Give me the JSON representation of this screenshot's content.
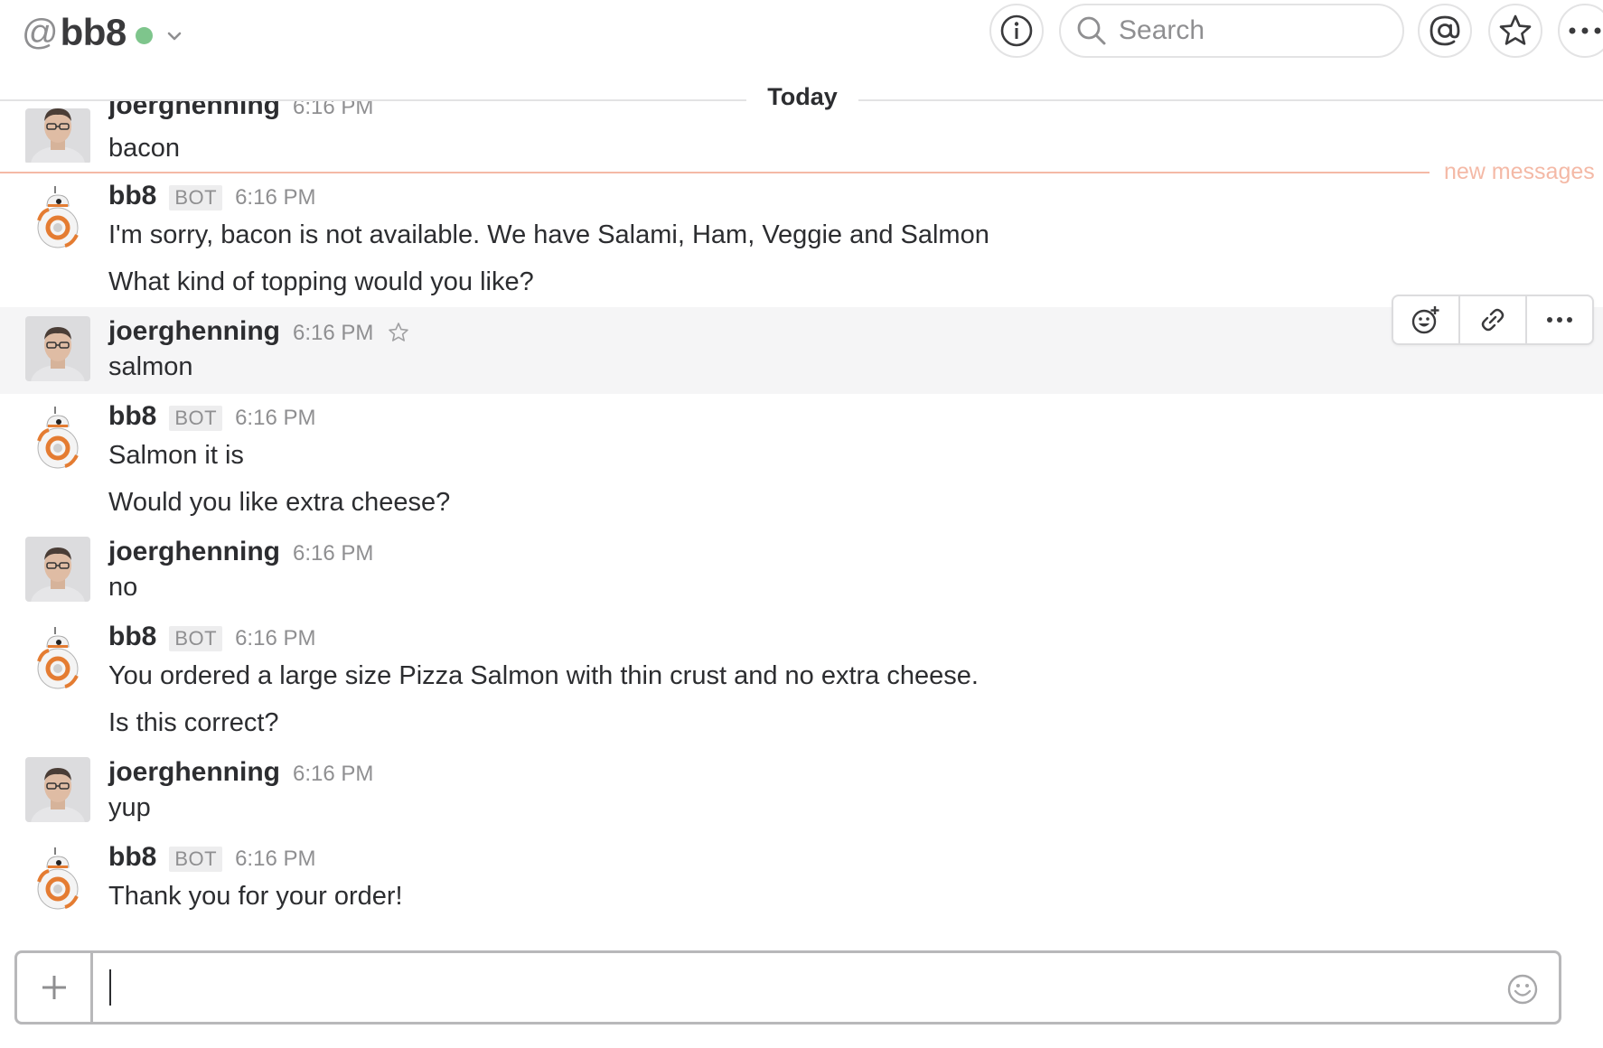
{
  "header": {
    "at_symbol": "@",
    "channel_name": "bb8",
    "search_placeholder": "Search"
  },
  "day_divider": "Today",
  "new_messages_label": "new messages",
  "messages": [
    {
      "author": "joerghenning",
      "time": "6:16 PM",
      "lines": [
        "bacon"
      ]
    },
    {
      "author": "bb8",
      "badge": "BOT",
      "time": "6:16 PM",
      "lines": [
        "I'm sorry, bacon is not available. We have Salami, Ham, Veggie and Salmon",
        "What kind of topping would you like?"
      ]
    },
    {
      "author": "joerghenning",
      "time": "6:16 PM",
      "lines": [
        "salmon"
      ]
    },
    {
      "author": "bb8",
      "badge": "BOT",
      "time": "6:16 PM",
      "lines": [
        "Salmon it is",
        "Would you like extra cheese?"
      ]
    },
    {
      "author": "joerghenning",
      "time": "6:16 PM",
      "lines": [
        "no"
      ]
    },
    {
      "author": "bb8",
      "badge": "BOT",
      "time": "6:16 PM",
      "lines": [
        "You ordered a large size Pizza Salmon with thin crust and no extra cheese.",
        "Is this correct?"
      ]
    },
    {
      "author": "joerghenning",
      "time": "6:16 PM",
      "lines": [
        "yup"
      ]
    },
    {
      "author": "bb8",
      "badge": "BOT",
      "time": "6:16 PM",
      "lines": [
        "Thank you for your order!"
      ]
    }
  ],
  "colors": {
    "presence": "#7ec58c",
    "new_messages": "#f4b9a6",
    "text": "#2c2d30",
    "muted": "#8f8f91",
    "hover_row": "#f5f5f6"
  },
  "icons": {
    "info": "info-icon",
    "search": "search-icon",
    "mentions": "at-sign-icon",
    "starred": "star-icon",
    "more": "more-icon",
    "add_reaction": "add-reaction-icon",
    "copy_link": "link-icon",
    "composer_plus": "plus-icon",
    "composer_emoji": "emoji-icon"
  }
}
